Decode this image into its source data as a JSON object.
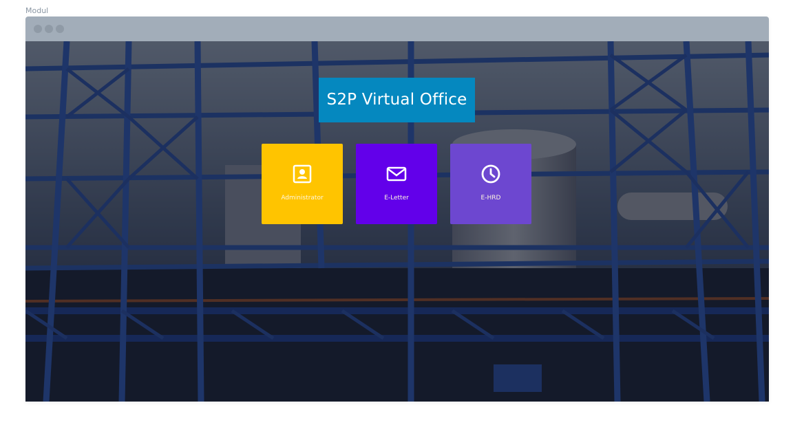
{
  "page": {
    "label": "Modul"
  },
  "window": {
    "controls": [
      "dot",
      "dot",
      "dot"
    ]
  },
  "header": {
    "title": "S2P Virtual Office"
  },
  "modules": [
    {
      "label": "Administrator",
      "icon": "contact-card-icon",
      "color": "#ffc400"
    },
    {
      "label": "E-Letter",
      "icon": "mail-icon",
      "color": "#6200ea"
    },
    {
      "label": "E-HRD",
      "icon": "clock-icon",
      "color": "#6d47d0"
    }
  ],
  "colors": {
    "titlebar": "#a2adb9",
    "title_bg": "#0588bf"
  }
}
